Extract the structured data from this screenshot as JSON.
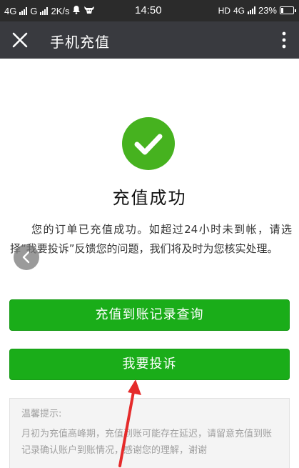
{
  "status_bar": {
    "network_1": "4G",
    "network_2": "G",
    "speed": "2K/s",
    "time": "14:50",
    "hd": "HD",
    "network_3": "4G",
    "battery": "23%",
    "battery_level": 0.23
  },
  "title_bar": {
    "title": "手机充值",
    "close_icon": "close-icon",
    "more_icon": "more-vertical-icon"
  },
  "result": {
    "icon": "checkmark-icon",
    "title": "充值成功",
    "description": "您的订单已充值成功。如超过24小时未到帐，请选择“我要投诉”反馈您的问题，我们将及时为您核实处理。"
  },
  "buttons": {
    "records": "充值到账记录查询",
    "complain": "我要投诉"
  },
  "tips": {
    "title": "温馨提示:",
    "body": "月初为充值高峰期，充值到账可能存在延迟，请留意充值到账记录确认账户到账情况，感谢您的理解，谢谢"
  },
  "colors": {
    "status_bar_bg": "#2b2b2b",
    "title_bar_bg": "#393a3f",
    "primary_green": "#1aad19",
    "success_green": "#46b21f",
    "annotation_red": "#e52b2b"
  }
}
